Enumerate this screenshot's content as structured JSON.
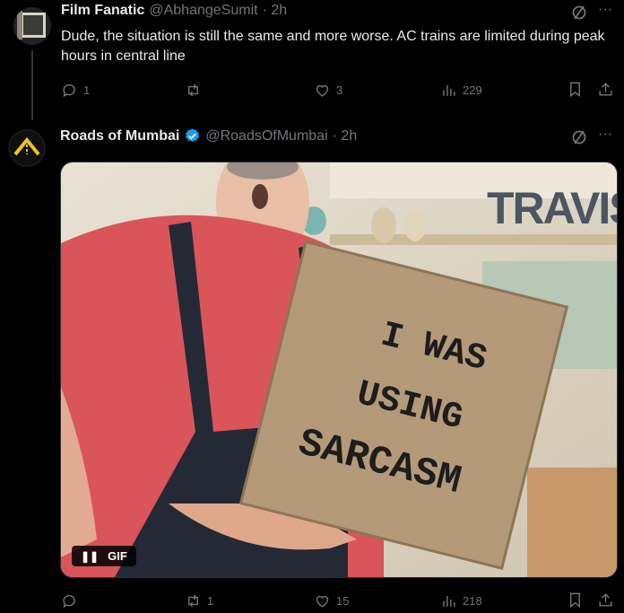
{
  "reply": {
    "name": "Film Fanatic",
    "handle": "@AbhangeSumit",
    "time": "· 2h",
    "text": "Dude, the situation is still the same and more worse. AC trains are limited during peak hours in central line",
    "actions": {
      "replies": "1",
      "retweets": "",
      "likes": "3",
      "views": "229"
    }
  },
  "tweet": {
    "name": "Roads of Mumbai",
    "handle": "@RoadsOfMumbai",
    "time": "· 2h",
    "media": {
      "watermark": "TRAVIS",
      "sign_lines": [
        "I WAS",
        "USING",
        "SARCASM"
      ],
      "gif_label": "GIF"
    },
    "actions": {
      "replies": "",
      "retweets": "1",
      "likes": "15",
      "views": "218"
    }
  },
  "colors": {
    "background": "#000000",
    "text": "#e7e9ea",
    "muted": "#71767b",
    "verified": "#1d9bf0"
  }
}
